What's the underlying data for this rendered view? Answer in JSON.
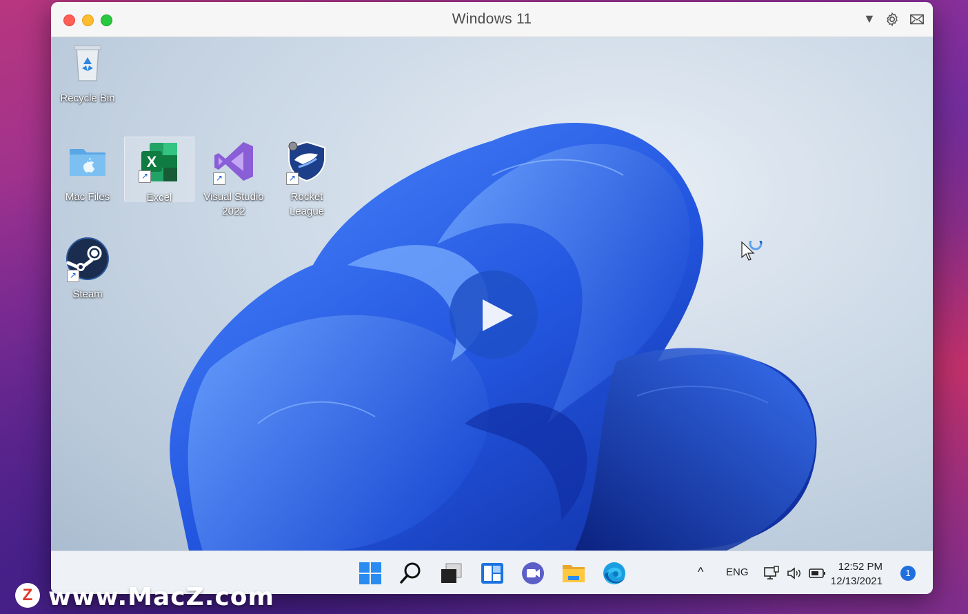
{
  "window": {
    "title": "Windows 11"
  },
  "titlebar_icons": {
    "dropdown": "▼",
    "gear_icon": "gear-icon",
    "mail_icon": "envelope-icon"
  },
  "desktop": {
    "icons": [
      {
        "label": "Recycle Bin",
        "icon": "recycle-bin-icon"
      },
      {
        "label": "Mac Files",
        "icon": "folder-icon"
      },
      {
        "label": "Excel",
        "icon": "excel-icon"
      },
      {
        "label": "Visual Studio 2022",
        "icon": "visual-studio-icon"
      },
      {
        "label": "Rocket League",
        "icon": "rocket-league-icon"
      },
      {
        "label": "Steam",
        "icon": "steam-icon"
      }
    ]
  },
  "taskbar": {
    "items": [
      "start-icon",
      "search-icon",
      "task-view-icon",
      "widgets-icon",
      "chat-icon",
      "file-explorer-icon",
      "edge-icon"
    ],
    "tray": {
      "language": "ENG",
      "time": "12:52 PM",
      "date": "12/13/2021",
      "notification_count": "1"
    }
  },
  "watermark": {
    "logo": "Z",
    "text": "www.MacZ.com"
  },
  "colors": {
    "accent": "#1f6fe0",
    "bloom": "#2b63e8"
  }
}
